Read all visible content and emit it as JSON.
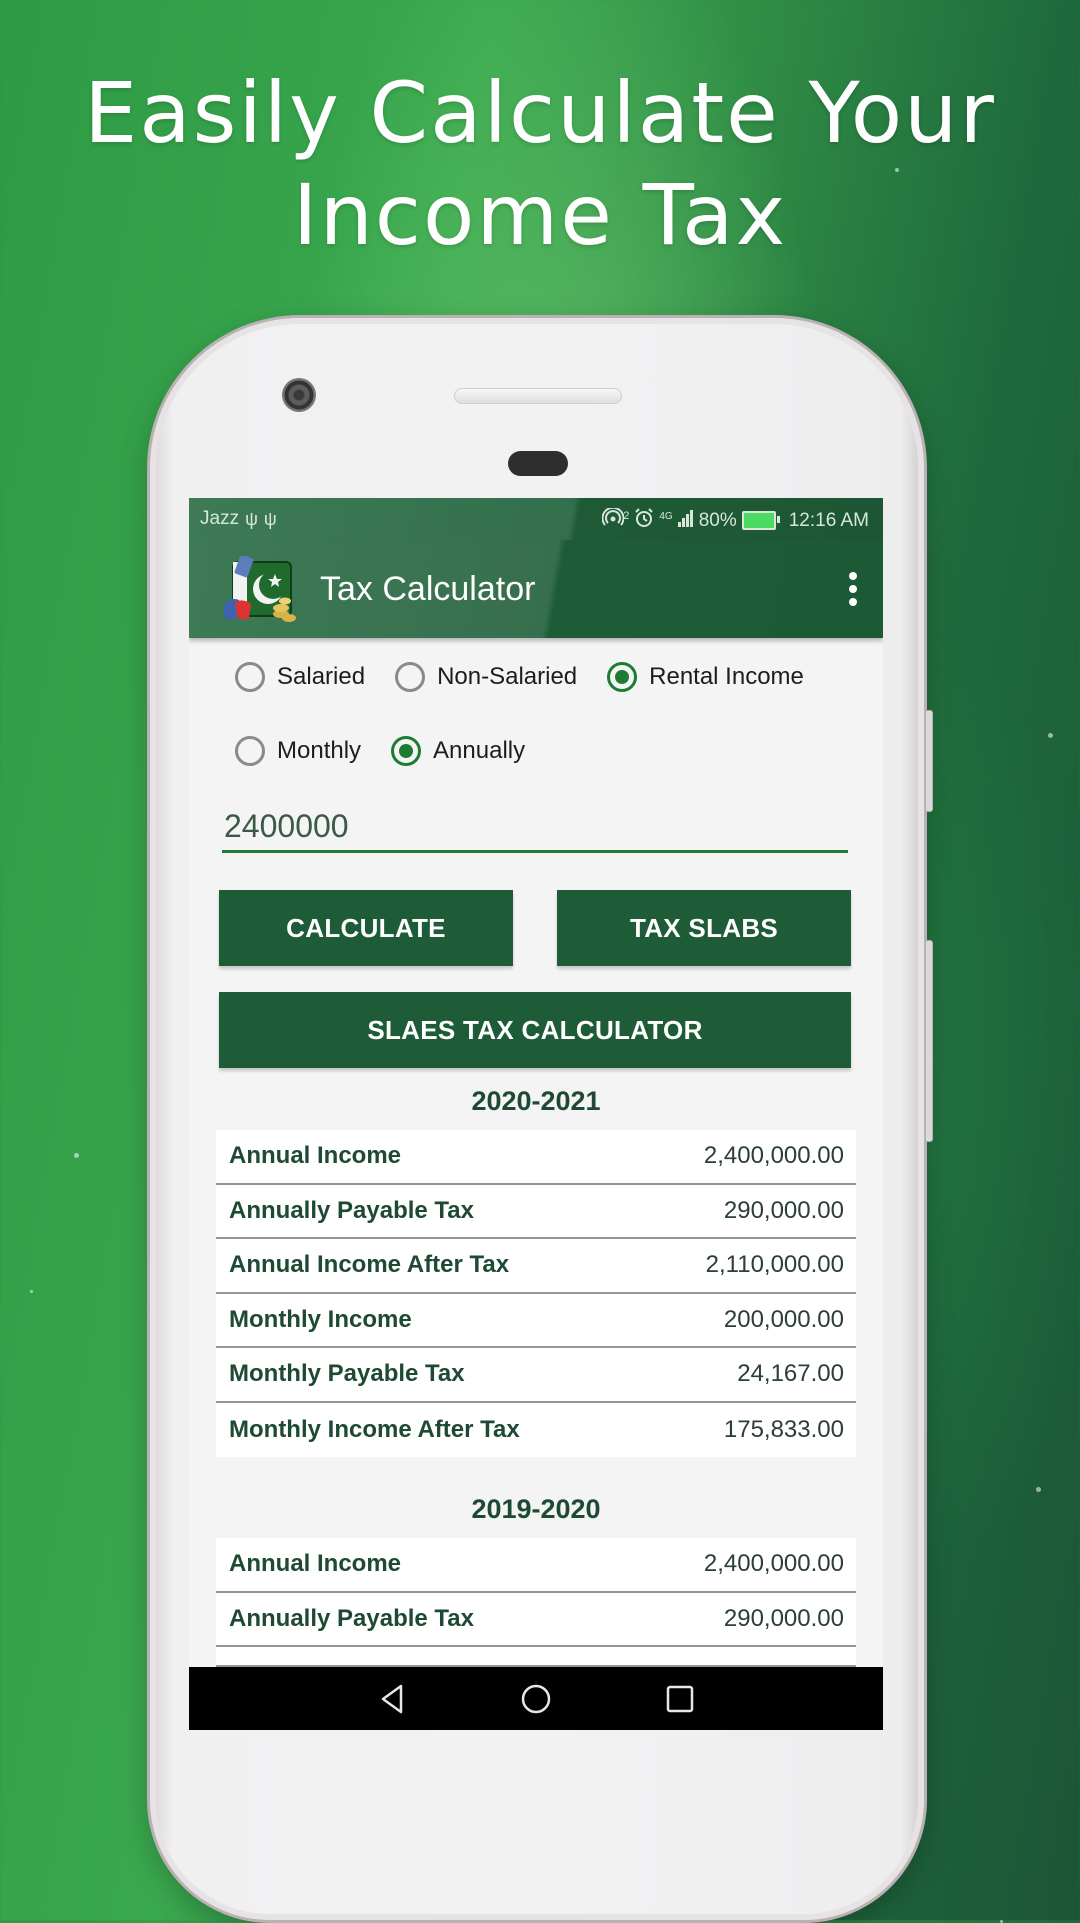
{
  "promo": {
    "headline_line1": "Easily Calculate Your",
    "headline_line2": "Income Tax"
  },
  "status_bar": {
    "carrier": "Jazz",
    "left_icons": [
      "usb-icon",
      "usb-icon"
    ],
    "right_icons": [
      "hotspot-icon",
      "alarm-icon",
      "4g-signal-icon",
      "battery-charging-icon"
    ],
    "hotspot_count": "2",
    "network": "4G",
    "battery": "80%",
    "time": "12:16 AM"
  },
  "toolbar": {
    "title": "Tax Calculator",
    "logo": "pakistan-flag-tax-logo",
    "menu_icon": "more-vert-icon"
  },
  "income_type": {
    "options": [
      {
        "label": "Salaried",
        "checked": false
      },
      {
        "label": "Non-Salaried",
        "checked": false
      },
      {
        "label": "Rental Income",
        "checked": true
      }
    ]
  },
  "period": {
    "options": [
      {
        "label": "Monthly",
        "checked": false
      },
      {
        "label": "Annually",
        "checked": true
      }
    ]
  },
  "amount_input": {
    "value": "2400000"
  },
  "buttons": {
    "calculate": "CALCULATE",
    "tax_slabs": "TAX SLABS",
    "sales_tax": "SLAES TAX CALCULATOR"
  },
  "results": [
    {
      "year": "2020-2021",
      "rows": [
        {
          "label": "Annual Income",
          "value": "2,400,000.00"
        },
        {
          "label": "Annually Payable Tax",
          "value": "290,000.00"
        },
        {
          "label": "Annual Income After Tax",
          "value": "2,110,000.00"
        },
        {
          "label": "Monthly Income",
          "value": "200,000.00"
        },
        {
          "label": "Monthly Payable Tax",
          "value": "24,167.00"
        },
        {
          "label": "Monthly Income After Tax",
          "value": "175,833.00"
        }
      ]
    },
    {
      "year": "2019-2020",
      "rows": [
        {
          "label": "Annual Income",
          "value": "2,400,000.00"
        },
        {
          "label": "Annually Payable Tax",
          "value": "290,000.00"
        }
      ]
    }
  ],
  "nav_bar": {
    "icons": [
      "back-icon",
      "home-icon",
      "recents-icon"
    ]
  },
  "colors": {
    "primary_dark": "#1d5c36",
    "accent": "#1e7b34",
    "label_text": "#1e4a33",
    "background_green": "#2f9a45"
  }
}
